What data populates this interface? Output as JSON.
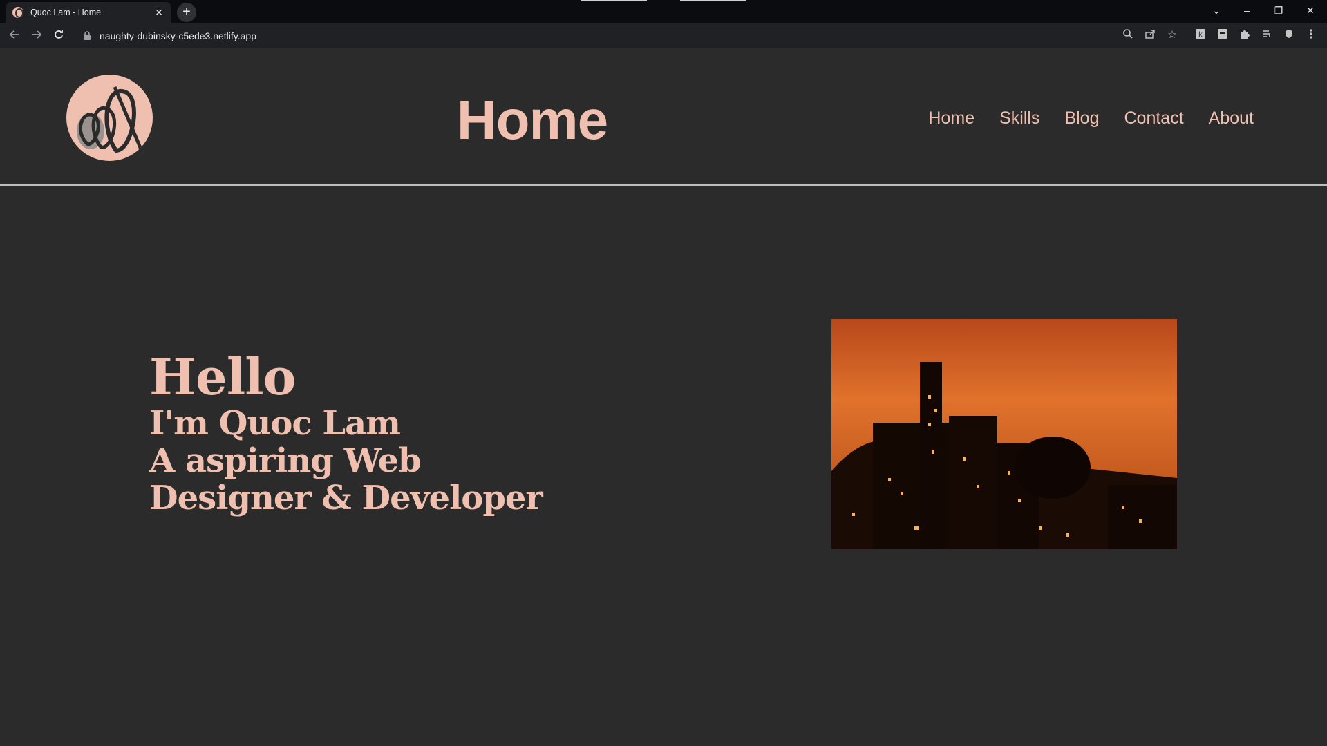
{
  "browser": {
    "tab_title": "Quoc Lam - Home",
    "tab_close": "✕",
    "new_tab": "+",
    "url": "naughty-dubinsky-c5ede3.netlify.app",
    "window_controls": {
      "dropdown": "⌄",
      "minimize": "–",
      "restore": "❐",
      "close": "✕"
    }
  },
  "header": {
    "title": "Home",
    "nav": [
      "Home",
      "Skills",
      "Blog",
      "Contact",
      "About"
    ]
  },
  "hero": {
    "hello": "Hello",
    "line1": "I'm Quoc Lam",
    "line2": "A aspiring Web",
    "line3": "Designer & Developer"
  },
  "colors": {
    "background": "#2b2b2b",
    "accent": "#efc0b0",
    "chrome": "#202124"
  },
  "icons": [
    "back-icon",
    "forward-icon",
    "reload-icon",
    "lock-icon",
    "zoom-icon",
    "share-icon",
    "star-icon",
    "extensions-icon",
    "menu-icon"
  ]
}
